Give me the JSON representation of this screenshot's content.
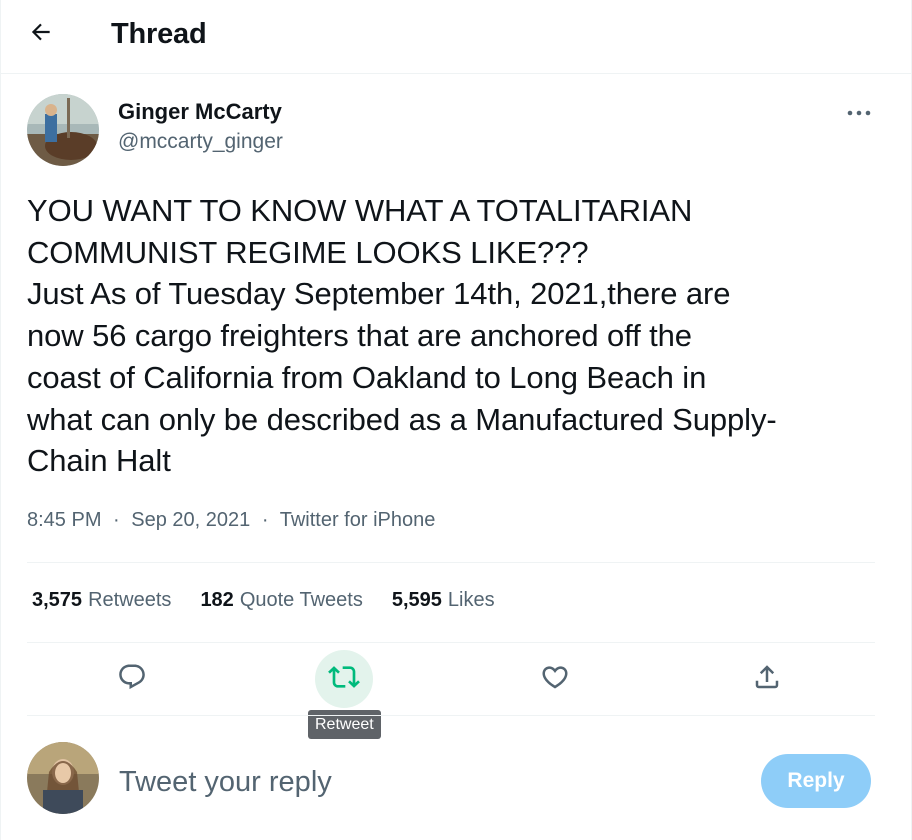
{
  "header": {
    "title": "Thread",
    "back_icon": "arrow-left-icon"
  },
  "tweet": {
    "author": {
      "name": "Ginger McCarty",
      "handle": "@mccarty_ginger"
    },
    "text": "YOU WANT TO KNOW WHAT A TOTALITARIAN\nCOMMUNIST REGIME LOOKS LIKE???\nJust As of Tuesday September 14th, 2021,there are\nnow 56 cargo freighters that are anchored off the\ncoast of California from Oakland to Long Beach in\nwhat can only be described as a Manufactured Supply-\nChain Halt",
    "time": "8:45 PM",
    "date": "Sep 20, 2021",
    "separator": "·",
    "source": "Twitter for iPhone",
    "stats": {
      "retweets_count": "3,575",
      "retweets_label": "Retweets",
      "quotes_count": "182",
      "quotes_label": "Quote Tweets",
      "likes_count": "5,595",
      "likes_label": "Likes"
    },
    "actions": {
      "reply_icon": "reply-icon",
      "retweet_icon": "retweet-icon",
      "like_icon": "heart-icon",
      "share_icon": "share-icon",
      "tooltip": "Retweet"
    }
  },
  "composer": {
    "placeholder": "Tweet your reply",
    "button_label": "Reply"
  },
  "colors": {
    "text_primary": "#0f1419",
    "text_secondary": "#536471",
    "retweet_green": "#00ba7c",
    "retweet_hover_bg": "#e3f3ec",
    "reply_button_disabled": "#8ecdf8",
    "border": "#eff3f4"
  }
}
